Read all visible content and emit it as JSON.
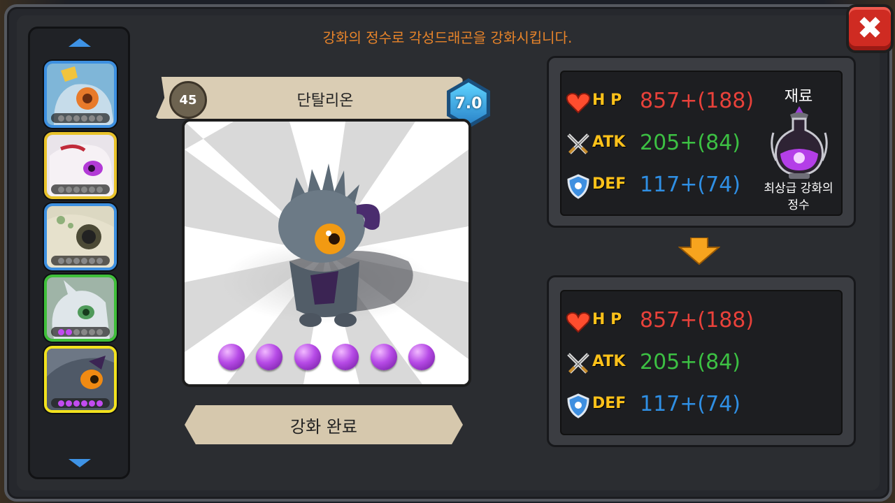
{
  "instruction": "강화의 정수로 각성드래곤을 강화시킵니다.",
  "close_label": "✖",
  "side_list": {
    "slots": [
      {
        "name": "dragon-slot-1",
        "border": "#3c8fe0",
        "gems": 0
      },
      {
        "name": "dragon-slot-2",
        "border": "#e8c22a",
        "gems": 0
      },
      {
        "name": "dragon-slot-3",
        "border": "#3c8fe0",
        "gems": 0
      },
      {
        "name": "dragon-slot-4",
        "border": "#3fbf3a",
        "gems": 2
      },
      {
        "name": "dragon-slot-5",
        "border": "#f2e21e",
        "gems": 6
      }
    ]
  },
  "dragon": {
    "level": "45",
    "name": "단탈리온",
    "grade": "7.0",
    "gems_filled": 6
  },
  "complete_button": "강화 완료",
  "current_stats": {
    "hp_label": "H P",
    "hp_value": "857+(188)",
    "atk_label": "ATK",
    "atk_value": "205+(84)",
    "def_label": "DEF",
    "def_value": "117+(74)"
  },
  "material": {
    "title": "재료",
    "name_line1": "최상급 강화의",
    "name_line2": "정수",
    "icon": "potion-flask-icon"
  },
  "result_stats": {
    "hp_label": "H P",
    "hp_value": "857+(188)",
    "atk_label": "ATK",
    "atk_value": "205+(84)",
    "def_label": "DEF",
    "def_value": "117+(74)"
  },
  "colors": {
    "hp": "#e8413a",
    "atk": "#3cc043",
    "def": "#2f8fe4",
    "label": "#ffc21a",
    "instruction": "#e8842a"
  }
}
